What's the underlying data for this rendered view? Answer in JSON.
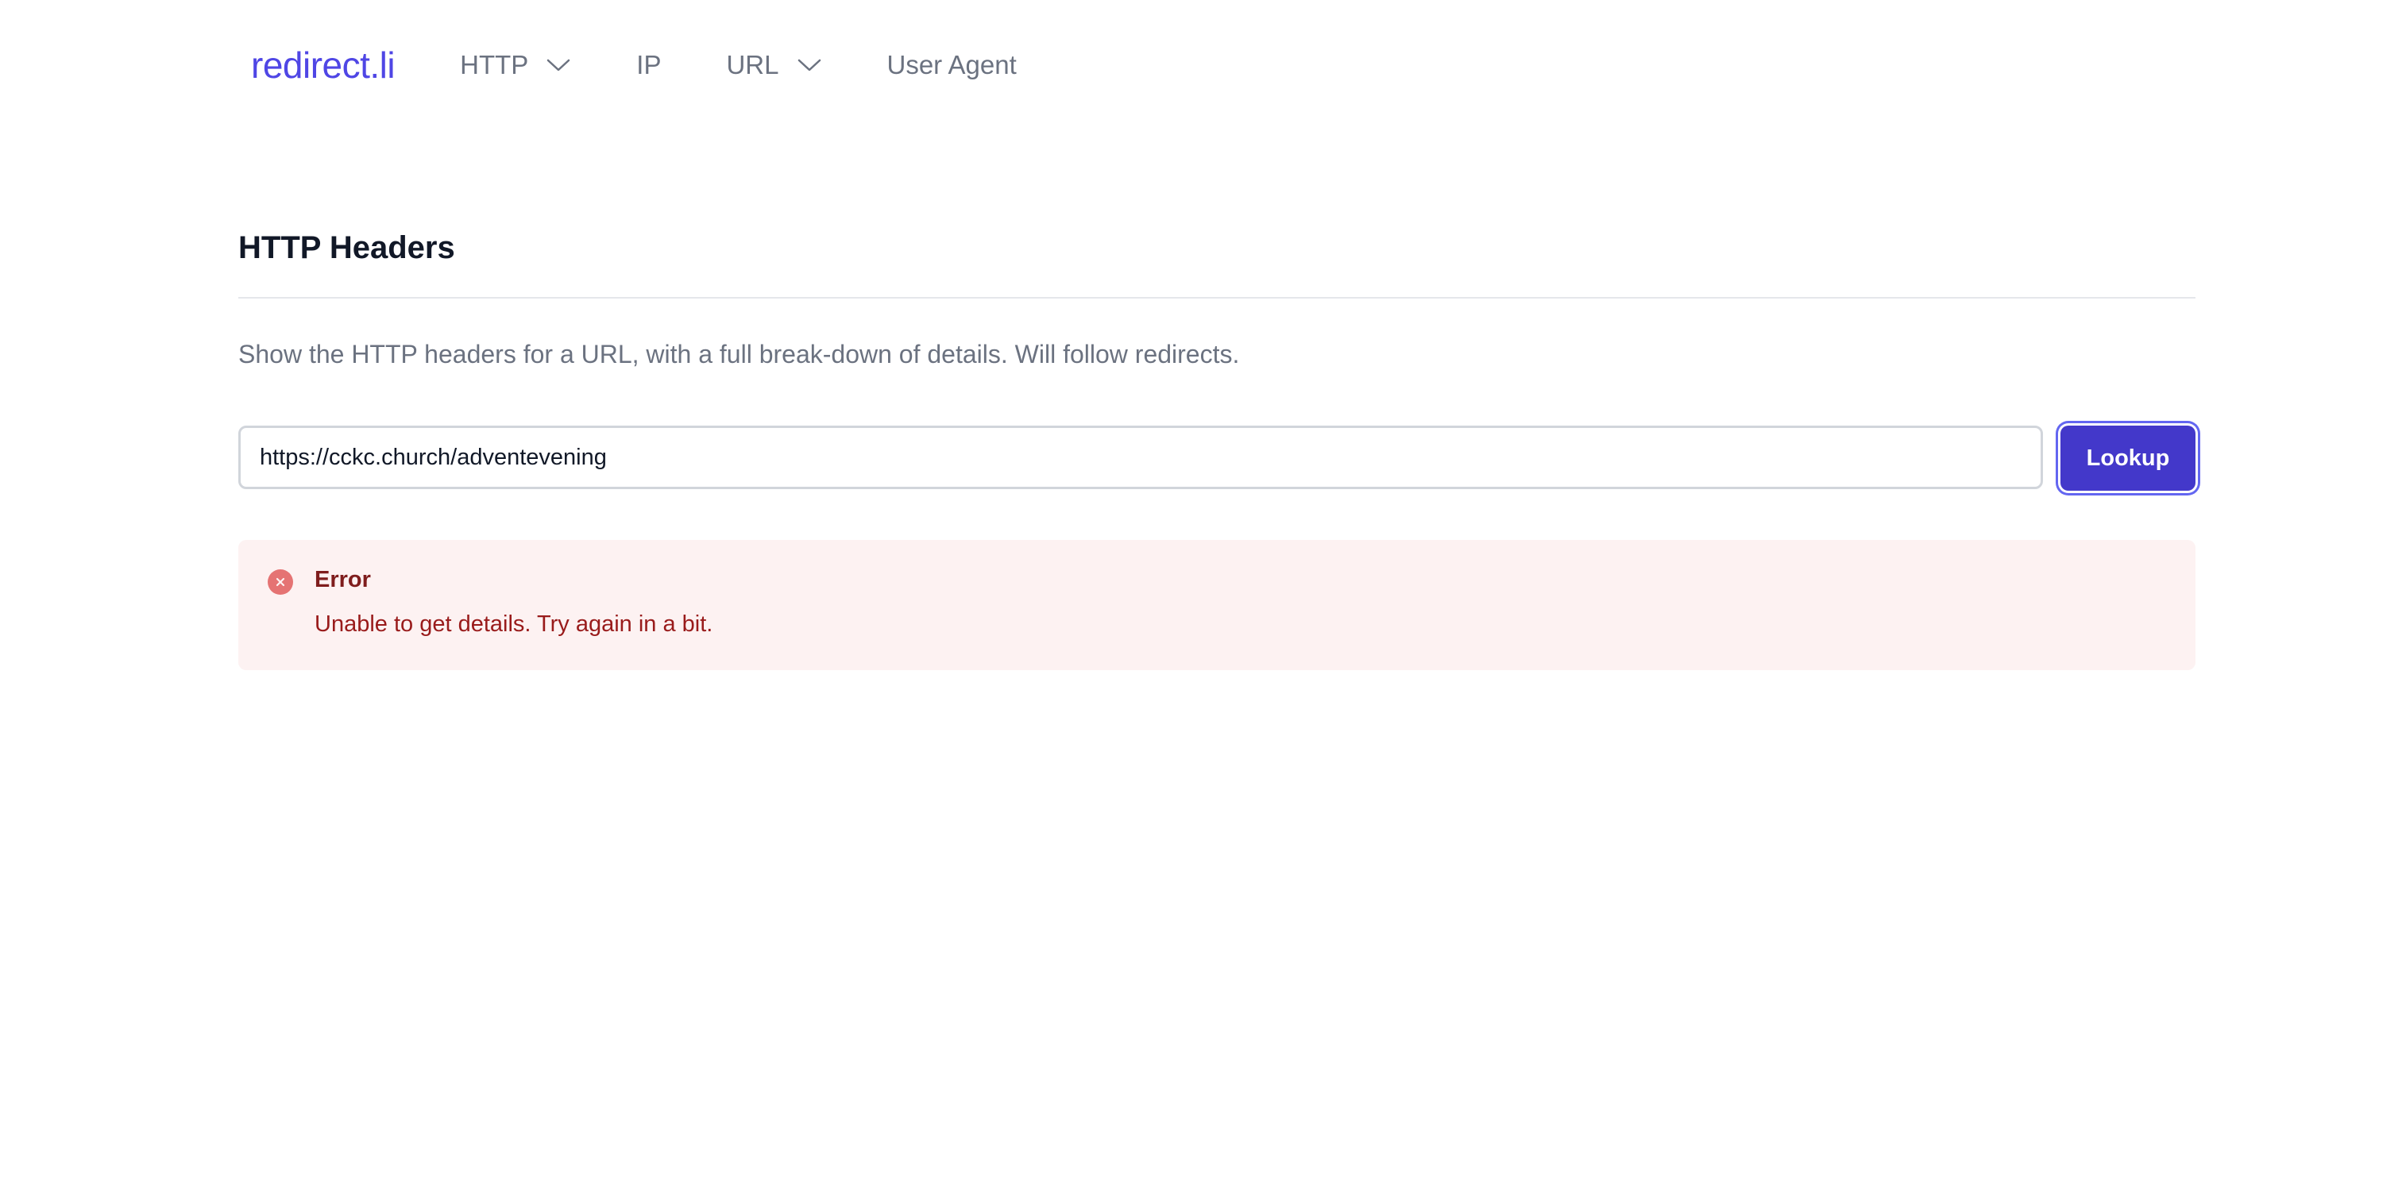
{
  "nav": {
    "logo": "redirect.li",
    "items": [
      {
        "label": "HTTP",
        "has_dropdown": true
      },
      {
        "label": "IP",
        "has_dropdown": false
      },
      {
        "label": "URL",
        "has_dropdown": true
      },
      {
        "label": "User Agent",
        "has_dropdown": false
      }
    ]
  },
  "page": {
    "title": "HTTP Headers",
    "description": "Show the HTTP headers for a URL, with a full break-down of details. Will follow redirects."
  },
  "lookup": {
    "url_value": "https://cckc.church/adventevening",
    "button_label": "Lookup"
  },
  "alert": {
    "title": "Error",
    "message": "Unable to get details. Try again in a bit.",
    "icon": "x-circle-icon"
  },
  "colors": {
    "brand": "#4f46e5",
    "button": "#4338ca",
    "alert_bg": "#fdf2f2",
    "alert_icon": "#e57373",
    "alert_text": "#991b1b"
  }
}
